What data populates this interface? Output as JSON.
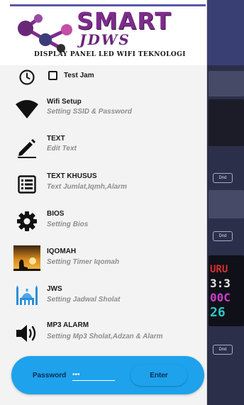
{
  "brand": {
    "title": "SMART",
    "subtitle": "JDWS",
    "tagline": "DISPLAY PANEL LED WIFI TEKNOLOGI"
  },
  "test_jam": {
    "label": "Test Jam",
    "checked": false
  },
  "menu": [
    {
      "icon": "wifi-icon",
      "title": "Wifi Setup",
      "subtitle": "Setting SSID & Password"
    },
    {
      "icon": "pencil-icon",
      "title": "TEXT",
      "subtitle": "Edit Text"
    },
    {
      "icon": "list-icon",
      "title": "TEXT KHUSUS",
      "subtitle": "Text Jumlat,Iqmh,Alarm"
    },
    {
      "icon": "gear-icon",
      "title": "BIOS",
      "subtitle": "Setting Bios"
    },
    {
      "icon": "prayer-image-icon",
      "title": "IQOMAH",
      "subtitle": "Setting Timer Iqomah"
    },
    {
      "icon": "mosque-icon",
      "title": "JWS",
      "subtitle": "Setting Jadwal Sholat"
    },
    {
      "icon": "speaker-icon",
      "title": "MP3 ALARM",
      "subtitle": "Setting Mp3 Sholat,Adzan & Alarm"
    }
  ],
  "password": {
    "label": "Password",
    "value": "•••",
    "enter_label": "Enter"
  },
  "background": {
    "clock_lines": [
      "URU",
      "3:3",
      "00C",
      "26"
    ],
    "tile_button_label": "Dnd"
  },
  "colors": {
    "brand_purple": "#7d2c8c",
    "accent_blue": "#1ea2ec",
    "drawer_bg": "#f3f3f3"
  }
}
